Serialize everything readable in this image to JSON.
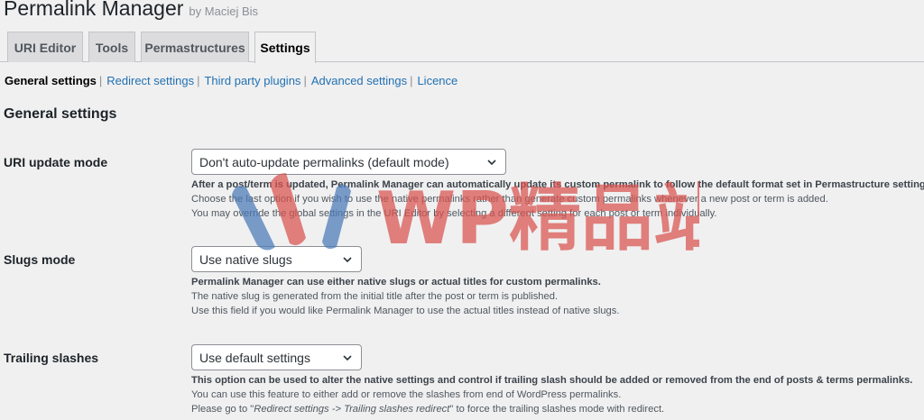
{
  "header": {
    "title": "Permalink Manager",
    "byline": "by Maciej Bis"
  },
  "tabs": [
    {
      "label": "URI Editor",
      "active": false
    },
    {
      "label": "Tools",
      "active": false
    },
    {
      "label": "Permastructures",
      "active": false
    },
    {
      "label": "Settings",
      "active": true
    }
  ],
  "subnav": {
    "current": "General settings",
    "links": [
      "Redirect settings",
      "Third party plugins",
      "Advanced settings",
      "Licence"
    ],
    "separator": "|"
  },
  "section": {
    "title": "General settings"
  },
  "rows": [
    {
      "label": "URI update mode",
      "selected": "Don't auto-update permalinks (default mode)",
      "desc": [
        "After a post/term is updated, Permalink Manager can automatically update its custom permalink to follow the default format set in Permastructure settings.",
        "Choose the last option if you wish to use the native permalinks rather than generate custom permalinks whenever a new post or term is added.",
        "You may override the global settings in the URI Editor by selecting a different setting for each post or term individually."
      ]
    },
    {
      "label": "Slugs mode",
      "selected": "Use native slugs",
      "desc": [
        "Permalink Manager can use either native slugs or actual titles for custom permalinks.",
        "The native slug is generated from the initial title after the post or term is published.",
        "Use this field if you would like Permalink Manager to use the actual titles instead of native slugs."
      ]
    },
    {
      "label": "Trailing slashes",
      "selected": "Use default settings",
      "desc": [
        "This option can be used to alter the native settings and control if trailing slash should be added or removed from the end of posts & terms permalinks.",
        "You can use this feature to either add or remove the slashes from end of WordPress permalinks."
      ],
      "desc3": {
        "before": "Please go to \"",
        "emphasis": "Redirect settings -> Trailing slashes redirect",
        "after": "\" to force the trailing slashes mode with redirect."
      }
    }
  ],
  "watermark": {
    "text": "WP精品站",
    "colors": {
      "blue": "#4a7ab8",
      "red": "#d9534f"
    }
  },
  "colors": {
    "background": "#f0f0f1",
    "link": "#2271b1",
    "text": "#1d2327"
  }
}
